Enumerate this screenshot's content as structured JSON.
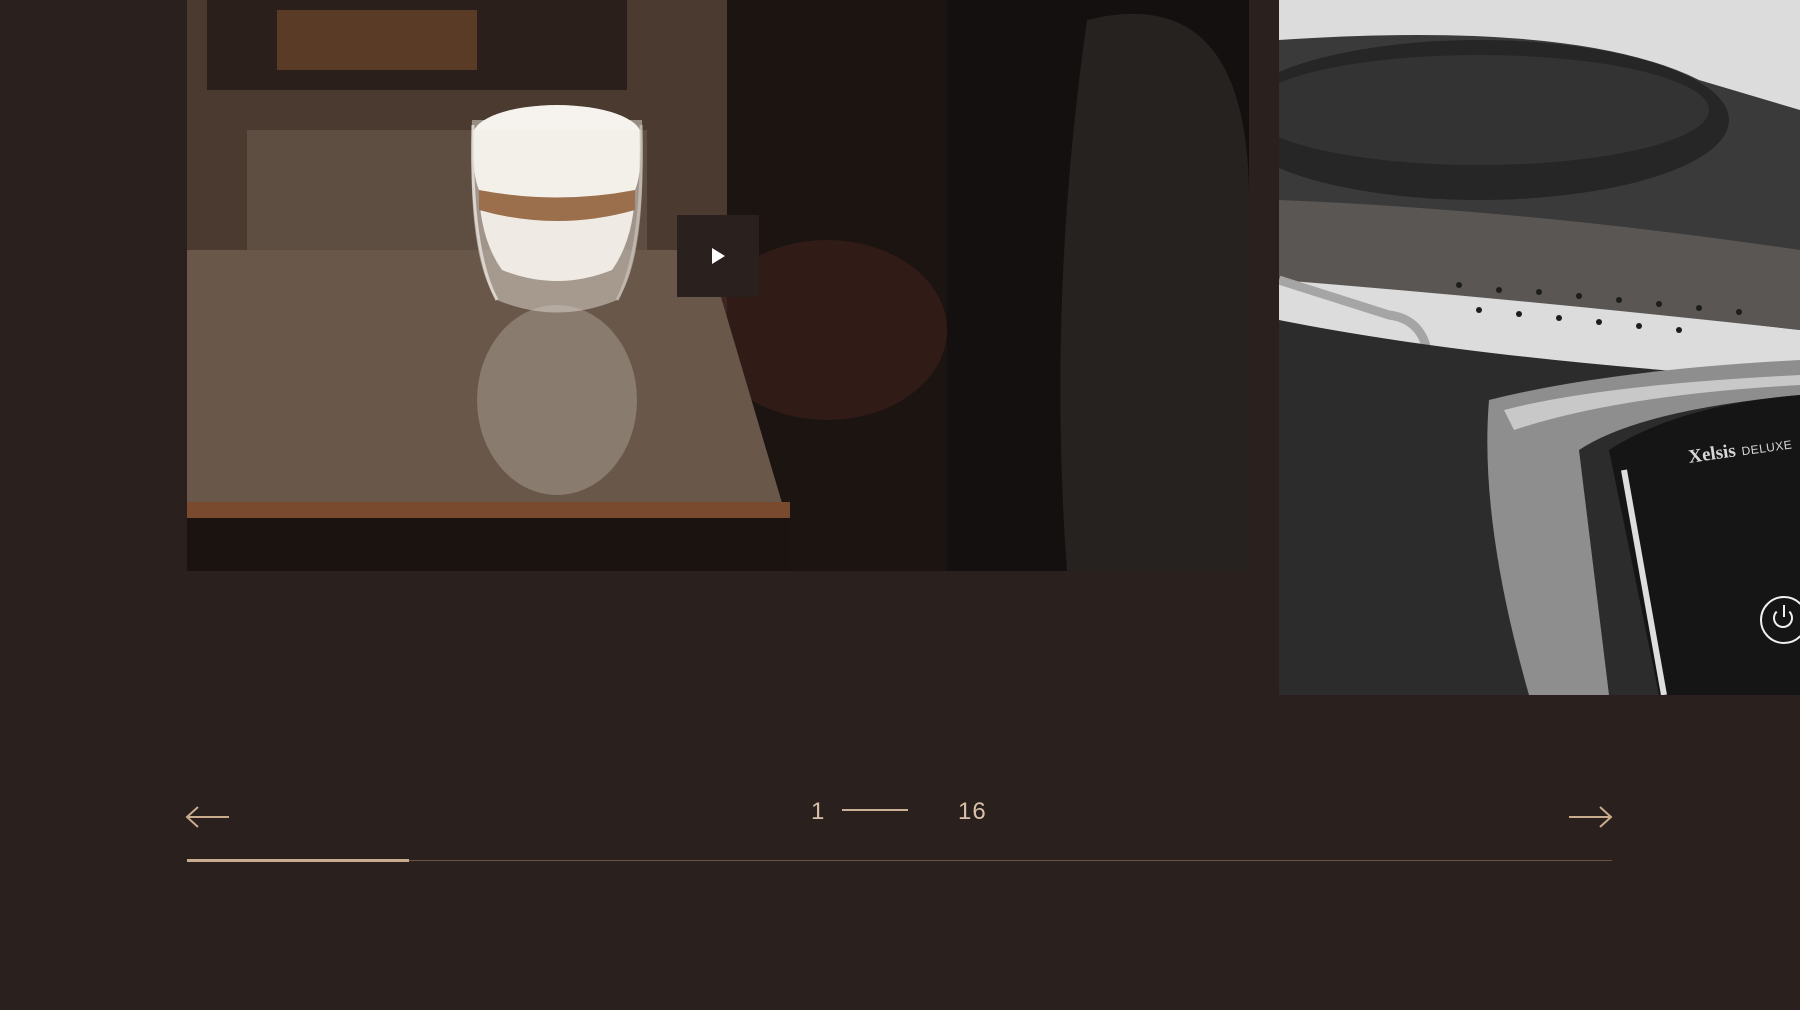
{
  "carousel": {
    "current": "1",
    "total": "16",
    "progress": 0.156,
    "prev_icon": "arrow-left-icon",
    "next_icon": "arrow-right-icon"
  },
  "slides": [
    {
      "kind": "video",
      "subject": "latte macchiato glass on table",
      "play_icon": "play-icon"
    },
    {
      "kind": "image",
      "subject": "espresso machine close-up",
      "brand": "Xelsis",
      "brand_suffix": "DELUXE",
      "power_icon": "power-icon"
    }
  ],
  "colors": {
    "background": "#2a201e",
    "accent": "#c9ac8d",
    "text": "#d8c1a8"
  }
}
